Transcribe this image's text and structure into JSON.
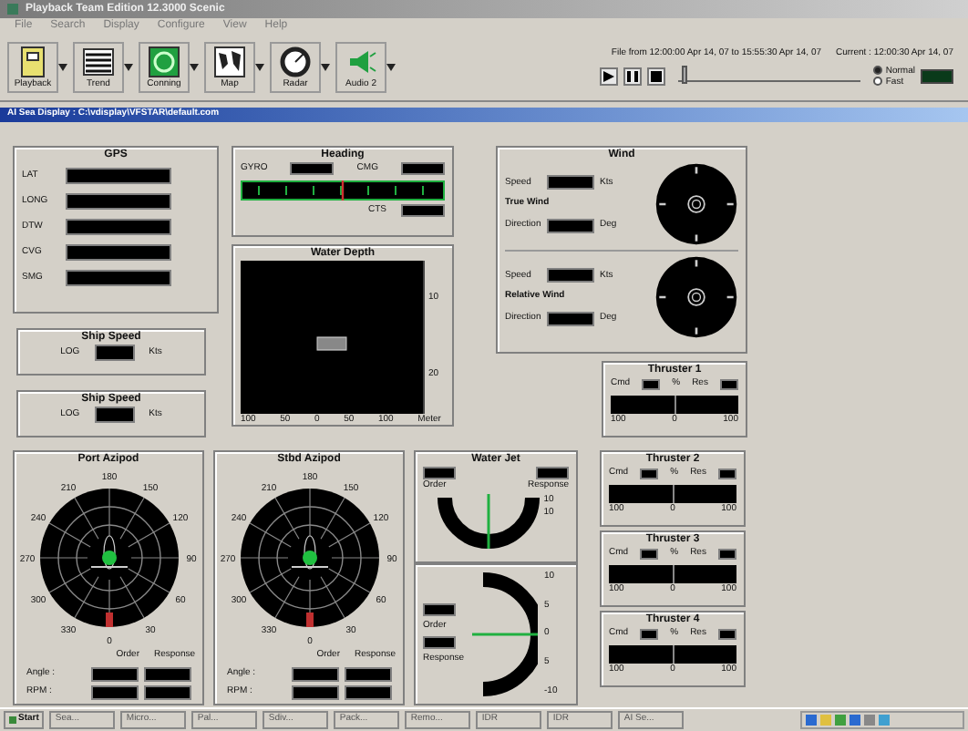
{
  "window": {
    "title": "Playback Team Edition 12.3000 Scenic"
  },
  "menu": [
    "File",
    "Search",
    "Display",
    "Configure",
    "View",
    "Help"
  ],
  "toolbar": [
    {
      "label": "Playback",
      "kind": "playback"
    },
    {
      "label": "Trend",
      "kind": "trend"
    },
    {
      "label": "Conning",
      "kind": "conning"
    },
    {
      "label": "Map",
      "kind": "map"
    },
    {
      "label": "Radar",
      "kind": "radar"
    },
    {
      "label": "Audio 2",
      "kind": "audio"
    }
  ],
  "playback": {
    "range": "File from 12:00:00 Apr 14, 07 to 15:55:30 Apr 14, 07",
    "current": "Current : 12:00:30 Apr 14, 07",
    "level": 0.02,
    "modes": [
      {
        "label": "Normal",
        "selected": true
      },
      {
        "label": "Fast",
        "selected": false
      }
    ]
  },
  "subwindow": {
    "title": "AI Sea Display : C:\\vdisplay\\VFSTAR\\default.com"
  },
  "gps": {
    "title": "GPS",
    "fields": [
      "LAT",
      "LONG",
      "DTW",
      "CVG",
      "SMG"
    ]
  },
  "ship_speeds": [
    {
      "title": "Ship Speed",
      "label": "LOG",
      "unit": "Kts"
    },
    {
      "title": "Ship Speed",
      "label": "LOG",
      "unit": "Kts"
    }
  ],
  "heading": {
    "title": "Heading",
    "left": "GYRO",
    "right": "CMG",
    "bottom": "CTS"
  },
  "water_depth": {
    "title": "Water Depth",
    "yticks": [
      "10",
      "20"
    ],
    "xticks": [
      "100",
      "50",
      "0",
      "50",
      "100"
    ],
    "unit": "Meter"
  },
  "wind": {
    "title": "Wind",
    "sections": [
      {
        "name": "True Wind",
        "speed": "Speed",
        "speed_unit": "Kts",
        "direction": "Direction",
        "direction_unit": "Deg"
      },
      {
        "name": "Relative Wind",
        "speed": "Speed",
        "speed_unit": "Kts",
        "direction": "Direction",
        "direction_unit": "Deg"
      }
    ]
  },
  "azipods": [
    {
      "title": "Port Azipod",
      "order": "Order",
      "response": "Response",
      "rows": [
        "Angle :",
        "RPM :"
      ],
      "dial_labels": [
        "180",
        "150",
        "120",
        "90",
        "60",
        "30",
        "0",
        "330",
        "300",
        "270",
        "240",
        "210"
      ]
    },
    {
      "title": "Stbd Azipod",
      "order": "Order",
      "response": "Response",
      "rows": [
        "Angle :",
        "RPM :"
      ],
      "dial_labels": [
        "180",
        "150",
        "120",
        "90",
        "60",
        "30",
        "0",
        "330",
        "300",
        "270",
        "240",
        "210"
      ]
    }
  ],
  "water_jets": [
    {
      "kind": "horizontal",
      "title": "Water Jet",
      "order": "Order",
      "response": "Response",
      "scale": [
        "10",
        "10"
      ]
    },
    {
      "kind": "vertical",
      "order": "Order",
      "response": "Response",
      "scale": [
        "10",
        "5",
        "0",
        "5",
        "-10"
      ]
    }
  ],
  "thrusters": [
    {
      "title": "Thruster 1",
      "cmd": "Cmd",
      "pct": "%",
      "res": "Res",
      "scale": [
        "100",
        "0",
        "100"
      ]
    },
    {
      "title": "Thruster 2",
      "cmd": "Cmd",
      "pct": "%",
      "res": "Res",
      "scale": [
        "100",
        "0",
        "100"
      ]
    },
    {
      "title": "Thruster 3",
      "cmd": "Cmd",
      "pct": "%",
      "res": "Res",
      "scale": [
        "100",
        "0",
        "100"
      ]
    },
    {
      "title": "Thruster 4",
      "cmd": "Cmd",
      "pct": "%",
      "res": "Res",
      "scale": [
        "100",
        "0",
        "100"
      ]
    }
  ],
  "taskbar": {
    "start": "Start",
    "items": [
      "Sea...",
      "Micro...",
      "Pal...",
      "Sdiv...",
      "Pack...",
      "Remo...",
      "IDR",
      "IDR",
      "AI Se..."
    ]
  }
}
